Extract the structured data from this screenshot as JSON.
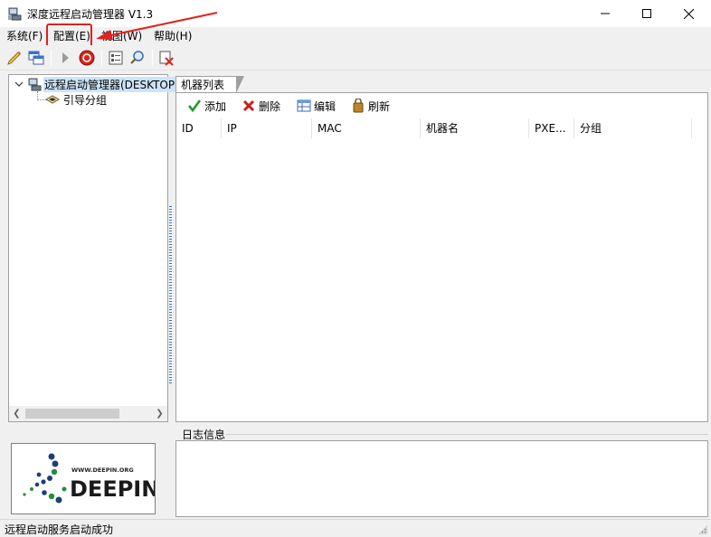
{
  "window": {
    "title": "深度远程启动管理器 V1.3",
    "controls": [
      "minimize",
      "maximize",
      "close"
    ]
  },
  "menu": {
    "items": [
      {
        "label": "系统(F)"
      },
      {
        "label": "配置(E)",
        "highlighted": true
      },
      {
        "label": "视图(W)"
      },
      {
        "label": "帮助(H)"
      }
    ]
  },
  "toolbar": {
    "icons": [
      "pencil-icon",
      "window-icon",
      "arrow-right-icon",
      "stop-icon",
      "properties-icon",
      "search-icon",
      "exit-icon"
    ]
  },
  "tree": {
    "root_label": "远程启动管理器(DESKTOP",
    "child_label": "引导分组"
  },
  "logo": {
    "site": "WWW.DEEPIN.ORG",
    "brand": "DEEPIN"
  },
  "tabs": {
    "machine_list": "机器列表"
  },
  "list_toolbar": {
    "add": "添加",
    "delete": "删除",
    "edit": "编辑",
    "refresh": "刷新"
  },
  "columns": [
    "ID",
    "IP",
    "MAC",
    "机器名",
    "PXE...",
    "分组"
  ],
  "log": {
    "label": "日志信息"
  },
  "status": {
    "text": "远程启动服务启动成功"
  },
  "colors": {
    "highlight_red": "#e0211d",
    "selection_blue": "#cce4f7"
  }
}
